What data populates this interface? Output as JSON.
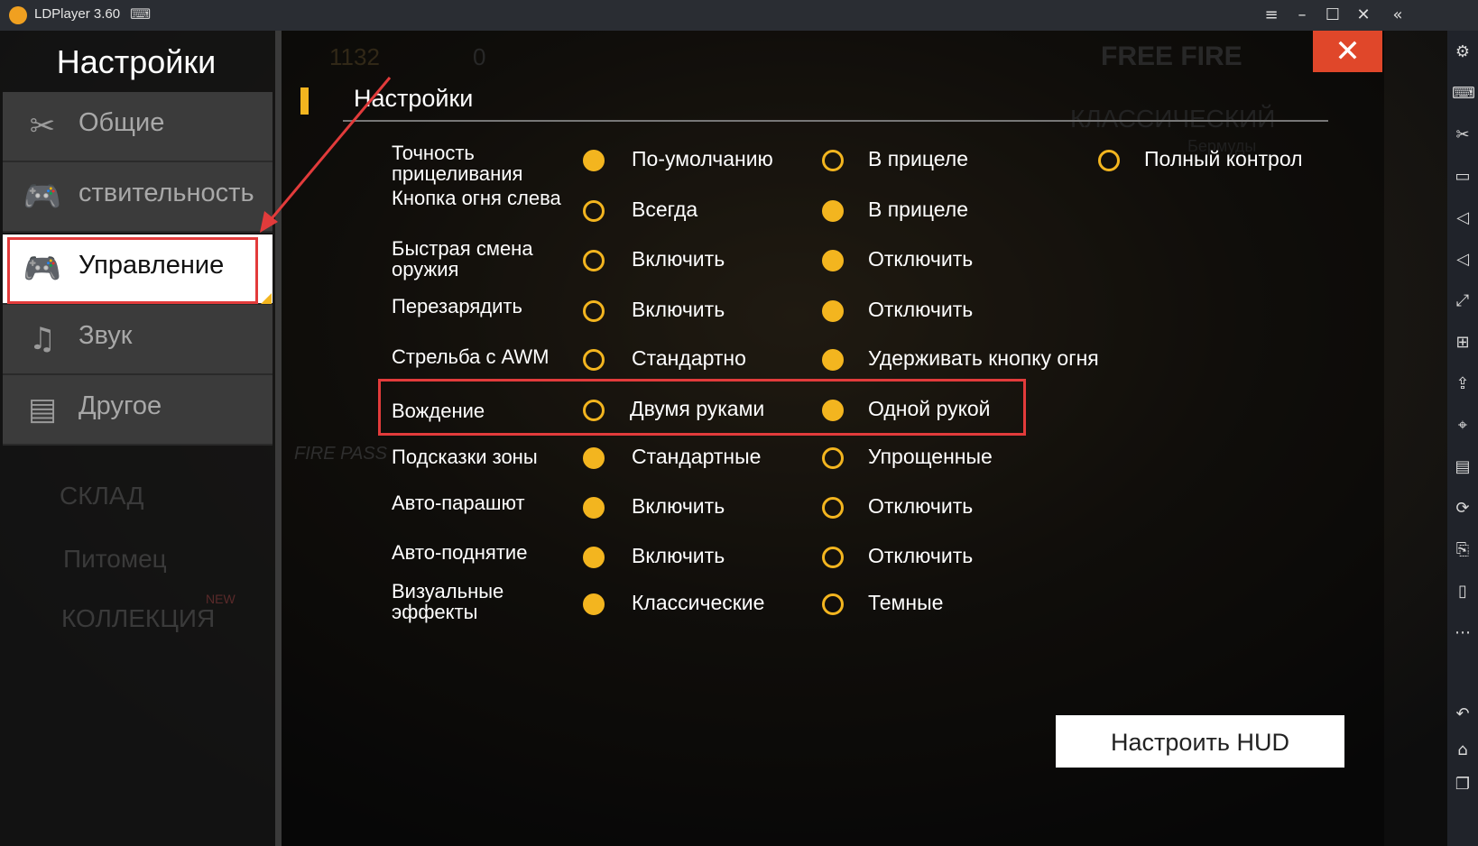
{
  "window": {
    "title": "LDPlayer 3.60"
  },
  "left_panel": {
    "title": "Настройки",
    "items": [
      {
        "label": "Общие",
        "icon": "tools-icon"
      },
      {
        "label": "ствительность",
        "icon": "gamepad-icon"
      },
      {
        "label": "Управление",
        "icon": "gamepad-icon"
      },
      {
        "label": "Звук",
        "icon": "music-note-icon"
      },
      {
        "label": "Другое",
        "icon": "document-icon"
      }
    ],
    "background_menu": [
      "СКЛАД",
      "Питомец",
      "КОЛЛЕКЦИЯ"
    ]
  },
  "background": {
    "coins": "1132",
    "diamonds": "0",
    "game_logo": "FREE FIRE",
    "mode": "КЛАССИЧЕСКИЙ",
    "map": "Бермуды",
    "fire_pass": "FIRE PASS",
    "new_badge": "NEW"
  },
  "settings": {
    "title": "Настройки",
    "rows": [
      {
        "label": "Точность прицеливания",
        "options": [
          {
            "label": "По-умолчанию",
            "selected": true
          },
          {
            "label": "В прицеле",
            "selected": false
          },
          {
            "label": "Полный контрол",
            "selected": false
          }
        ]
      },
      {
        "label": "Кнопка огня слева",
        "options": [
          {
            "label": "Всегда",
            "selected": false
          },
          {
            "label": "В прицеле",
            "selected": true
          }
        ]
      },
      {
        "label": "Быстрая смена оружия",
        "options": [
          {
            "label": "Включить",
            "selected": false
          },
          {
            "label": "Отключить",
            "selected": true
          }
        ]
      },
      {
        "label": "Перезарядить",
        "options": [
          {
            "label": "Включить",
            "selected": false
          },
          {
            "label": "Отключить",
            "selected": true
          }
        ]
      },
      {
        "label": "Стрельба с AWM",
        "options": [
          {
            "label": "Стандартно",
            "selected": false
          },
          {
            "label": "Удерживать кнопку огня",
            "selected": true
          }
        ]
      },
      {
        "label": "Вождение",
        "options": [
          {
            "label": "Двумя руками",
            "selected": false
          },
          {
            "label": "Одной рукой",
            "selected": true
          }
        ]
      },
      {
        "label": "Подсказки зоны",
        "options": [
          {
            "label": "Стандартные",
            "selected": true
          },
          {
            "label": "Упрощенные",
            "selected": false
          }
        ]
      },
      {
        "label": "Авто-парашют",
        "options": [
          {
            "label": "Включить",
            "selected": true
          },
          {
            "label": "Отключить",
            "selected": false
          }
        ]
      },
      {
        "label": "Авто-поднятие",
        "options": [
          {
            "label": "Включить",
            "selected": true
          },
          {
            "label": "Отключить",
            "selected": false
          }
        ]
      },
      {
        "label": "Визуальные эффекты",
        "options": [
          {
            "label": "Классические",
            "selected": true
          },
          {
            "label": "Темные",
            "selected": false
          }
        ]
      }
    ],
    "hud_button": "Настроить HUD"
  },
  "colors": {
    "accent": "#f3b51f",
    "highlight": "#e23b3b",
    "close": "#e0472a"
  }
}
